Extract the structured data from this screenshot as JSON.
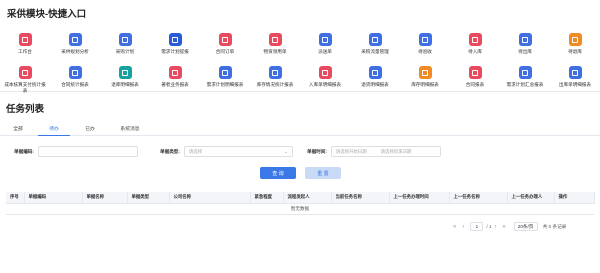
{
  "shortcuts": {
    "title": "采供模块-快捷入口",
    "items": [
      {
        "label": "工作台",
        "color": "#e84a5f",
        "icon": "workbench-icon"
      },
      {
        "label": "采供规划分析",
        "color": "#3f6fe0",
        "icon": "analysis-icon"
      },
      {
        "label": "采购计划",
        "color": "#3f6fe0",
        "icon": "plan-icon"
      },
      {
        "label": "需求计划提报",
        "color": "#2a5bd7",
        "icon": "clock-icon"
      },
      {
        "label": "合同订单",
        "color": "#e84a5f",
        "icon": "contract-icon"
      },
      {
        "label": "物资领用单",
        "color": "#e84a5f",
        "icon": "receipt-icon"
      },
      {
        "label": "派送单",
        "color": "#3f6fe0",
        "icon": "dispatch-icon"
      },
      {
        "label": "采购流量管理",
        "color": "#3f6fe0",
        "icon": "flow-icon"
      },
      {
        "label": "待验收",
        "color": "#3f6fe0",
        "icon": "check-icon"
      },
      {
        "label": "待入库",
        "color": "#e84a5f",
        "icon": "inbound-icon"
      },
      {
        "label": "待出库",
        "color": "#3f6fe0",
        "icon": "outbound-icon"
      },
      {
        "label": "待退库",
        "color": "#f08a24",
        "icon": "return-icon"
      },
      {
        "label": "成本核算支付统计报表",
        "color": "#e84a5f",
        "icon": "cost-report-icon"
      },
      {
        "label": "合同统计报表",
        "color": "#3f6fe0",
        "icon": "contract-report-icon"
      },
      {
        "label": "退库明细报表",
        "color": "#17a2a0",
        "icon": "return-report-icon"
      },
      {
        "label": "著者业务报表",
        "color": "#e84a5f",
        "icon": "business-report-icon"
      },
      {
        "label": "需求计划明细报表",
        "color": "#3f6fe0",
        "icon": "demand-report-icon"
      },
      {
        "label": "库存情况统计报表",
        "color": "#3f6fe0",
        "icon": "stock-report-icon"
      },
      {
        "label": "入库单明细报表",
        "color": "#e84a5f",
        "icon": "inbound-report-icon"
      },
      {
        "label": "退货明细报表",
        "color": "#3f6fe0",
        "icon": "refund-report-icon"
      },
      {
        "label": "库存明细报表",
        "color": "#f08a24",
        "icon": "stock-detail-icon"
      },
      {
        "label": "合同报表",
        "color": "#e84a5f",
        "icon": "contract-sheet-icon"
      },
      {
        "label": "需求计划汇总报表",
        "color": "#3f6fe0",
        "icon": "summary-report-icon"
      },
      {
        "label": "出库单明细报表",
        "color": "#3f6fe0",
        "icon": "outbound-report-icon"
      }
    ]
  },
  "task_list": {
    "title": "任务列表",
    "tabs": [
      {
        "label": "全部",
        "active": false
      },
      {
        "label": "待办",
        "active": true
      },
      {
        "label": "已办",
        "active": false
      },
      {
        "label": "系统消息",
        "active": false
      }
    ]
  },
  "filters": {
    "doc_no_label": "单据编码:",
    "doc_type_label": "单据类型:",
    "doc_type_placeholder": "请选择",
    "doc_time_label": "单据时间:",
    "start_placeholder": "请选择开始日期",
    "end_placeholder": "请选择结束日期"
  },
  "buttons": {
    "query": "查 询",
    "reset": "重 置"
  },
  "table": {
    "columns": [
      "序号",
      "单据编码",
      "单据名称",
      "单据类型",
      "公司名称",
      "紧急程度",
      "流程发起人",
      "当前任务名称",
      "上一任务办理时间",
      "上一任务名称",
      "上一任务办理人",
      "操作"
    ],
    "empty_text": "暂无数据"
  },
  "pagination": {
    "current_page": "1",
    "total_pages_text": "/ 1",
    "page_size": "20条/页",
    "total_text": "共 0 条记录"
  }
}
